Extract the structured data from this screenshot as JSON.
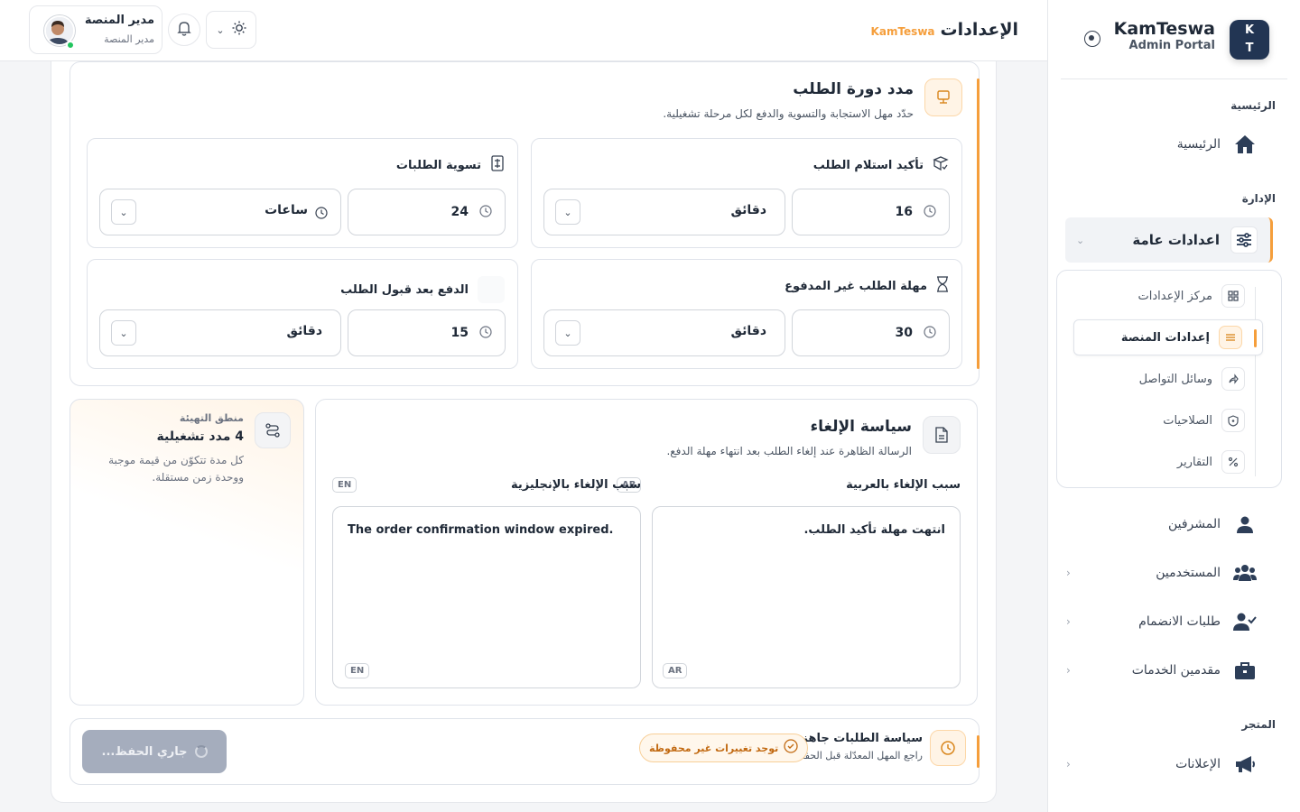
{
  "header": {
    "title": "الإعدادات",
    "brand_tag": "KamTeswa",
    "user_name": "مدير المنصة",
    "user_role": "مدير المنصة"
  },
  "sidebar": {
    "brand_name": "KamTeswa",
    "brand_sub": "Admin Portal",
    "avatar_l1": "K",
    "avatar_l2": "T",
    "sections": {
      "home": "الرئيسية",
      "admin": "الإدارة",
      "store": "المتجر"
    },
    "items": {
      "home": "الرئيسية",
      "general": "اعدادات عامة",
      "supervisors": "المشرفين",
      "users": "المستخدمين",
      "join_requests": "طلبات الانضمام",
      "providers": "مقدمين الخدمات",
      "ads": "الإعلانات"
    },
    "sub_items": {
      "settings_center": "مركز الإعدادات",
      "platform_settings": "إعدادات المنصة",
      "social": "وسائل التواصل",
      "permissions": "الصلاحيات",
      "reports": "التقارير"
    }
  },
  "lifecycle": {
    "title": "مدد دورة الطلب",
    "subtitle": "حدّد مهل الاستجابة والتسوية والدفع لكل مرحلة تشغيلية.",
    "fields": {
      "confirm": {
        "label": "تأكيد استلام الطلب",
        "value": "16",
        "unit": "دقائق"
      },
      "settlement": {
        "label": "تسوية الطلبات",
        "value": "24",
        "unit": "ساعات"
      },
      "unpaid": {
        "label": "مهلة الطلب غير المدفوع",
        "value": "30",
        "unit": "دقائق"
      },
      "payment": {
        "label": "الدفع بعد قبول الطلب",
        "value": "15",
        "unit": "دقائق"
      }
    }
  },
  "cancellation": {
    "title": "سياسة الإلغاء",
    "subtitle": "الرسالة الظاهرة عند إلغاء الطلب بعد انتهاء مهلة الدفع.",
    "ar_label": "سبب الإلغاء بالعربية",
    "en_label": "سبب الإلغاء بالإنجليزية",
    "ar_tag": "AR",
    "en_tag": "EN",
    "ar_text": "انتهت مهلة تأكيد الطلب.",
    "en_text": "The order confirmation window expired."
  },
  "logic": {
    "kicker": "منطق التهيئة",
    "title": "4 مدد تشغيلية",
    "desc": "كل مدة تتكوّن من قيمة موجبة ووحدة زمن مستقلة."
  },
  "footer": {
    "title": "سياسة الطلبات جاهزة",
    "subtitle": "راجع المهل المعدّلة قبل الحفظ.",
    "unsaved": "توجد تغييرات غير محفوظة",
    "save_label": "جاري الحفظ..."
  },
  "colors": {
    "accent": "#f59e3b",
    "navy": "#223553"
  }
}
